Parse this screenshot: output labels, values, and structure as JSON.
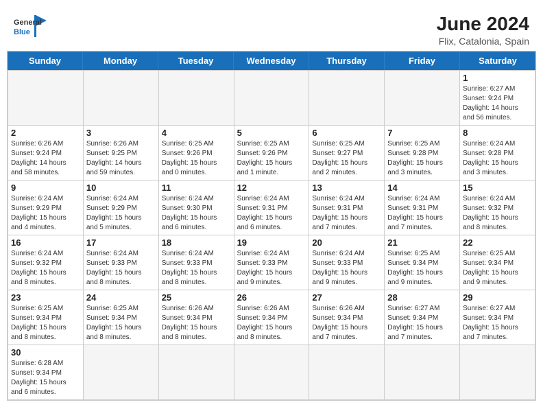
{
  "header": {
    "logo_general": "General",
    "logo_blue": "Blue",
    "title": "June 2024",
    "subtitle": "Flix, Catalonia, Spain"
  },
  "days": [
    "Sunday",
    "Monday",
    "Tuesday",
    "Wednesday",
    "Thursday",
    "Friday",
    "Saturday"
  ],
  "cells": [
    {
      "day": null,
      "empty": true
    },
    {
      "day": null,
      "empty": true
    },
    {
      "day": null,
      "empty": true
    },
    {
      "day": null,
      "empty": true
    },
    {
      "day": null,
      "empty": true
    },
    {
      "day": null,
      "empty": true
    },
    {
      "day": "1",
      "info": "Sunrise: 6:27 AM\nSunset: 9:24 PM\nDaylight: 14 hours\nand 56 minutes."
    },
    {
      "day": "2",
      "info": "Sunrise: 6:26 AM\nSunset: 9:24 PM\nDaylight: 14 hours\nand 58 minutes."
    },
    {
      "day": "3",
      "info": "Sunrise: 6:26 AM\nSunset: 9:25 PM\nDaylight: 14 hours\nand 59 minutes."
    },
    {
      "day": "4",
      "info": "Sunrise: 6:25 AM\nSunset: 9:26 PM\nDaylight: 15 hours\nand 0 minutes."
    },
    {
      "day": "5",
      "info": "Sunrise: 6:25 AM\nSunset: 9:26 PM\nDaylight: 15 hours\nand 1 minute."
    },
    {
      "day": "6",
      "info": "Sunrise: 6:25 AM\nSunset: 9:27 PM\nDaylight: 15 hours\nand 2 minutes."
    },
    {
      "day": "7",
      "info": "Sunrise: 6:25 AM\nSunset: 9:28 PM\nDaylight: 15 hours\nand 3 minutes."
    },
    {
      "day": "8",
      "info": "Sunrise: 6:24 AM\nSunset: 9:28 PM\nDaylight: 15 hours\nand 3 minutes."
    },
    {
      "day": "9",
      "info": "Sunrise: 6:24 AM\nSunset: 9:29 PM\nDaylight: 15 hours\nand 4 minutes."
    },
    {
      "day": "10",
      "info": "Sunrise: 6:24 AM\nSunset: 9:29 PM\nDaylight: 15 hours\nand 5 minutes."
    },
    {
      "day": "11",
      "info": "Sunrise: 6:24 AM\nSunset: 9:30 PM\nDaylight: 15 hours\nand 6 minutes."
    },
    {
      "day": "12",
      "info": "Sunrise: 6:24 AM\nSunset: 9:31 PM\nDaylight: 15 hours\nand 6 minutes."
    },
    {
      "day": "13",
      "info": "Sunrise: 6:24 AM\nSunset: 9:31 PM\nDaylight: 15 hours\nand 7 minutes."
    },
    {
      "day": "14",
      "info": "Sunrise: 6:24 AM\nSunset: 9:31 PM\nDaylight: 15 hours\nand 7 minutes."
    },
    {
      "day": "15",
      "info": "Sunrise: 6:24 AM\nSunset: 9:32 PM\nDaylight: 15 hours\nand 8 minutes."
    },
    {
      "day": "16",
      "info": "Sunrise: 6:24 AM\nSunset: 9:32 PM\nDaylight: 15 hours\nand 8 minutes."
    },
    {
      "day": "17",
      "info": "Sunrise: 6:24 AM\nSunset: 9:33 PM\nDaylight: 15 hours\nand 8 minutes."
    },
    {
      "day": "18",
      "info": "Sunrise: 6:24 AM\nSunset: 9:33 PM\nDaylight: 15 hours\nand 8 minutes."
    },
    {
      "day": "19",
      "info": "Sunrise: 6:24 AM\nSunset: 9:33 PM\nDaylight: 15 hours\nand 9 minutes."
    },
    {
      "day": "20",
      "info": "Sunrise: 6:24 AM\nSunset: 9:33 PM\nDaylight: 15 hours\nand 9 minutes."
    },
    {
      "day": "21",
      "info": "Sunrise: 6:25 AM\nSunset: 9:34 PM\nDaylight: 15 hours\nand 9 minutes."
    },
    {
      "day": "22",
      "info": "Sunrise: 6:25 AM\nSunset: 9:34 PM\nDaylight: 15 hours\nand 9 minutes."
    },
    {
      "day": "23",
      "info": "Sunrise: 6:25 AM\nSunset: 9:34 PM\nDaylight: 15 hours\nand 8 minutes."
    },
    {
      "day": "24",
      "info": "Sunrise: 6:25 AM\nSunset: 9:34 PM\nDaylight: 15 hours\nand 8 minutes."
    },
    {
      "day": "25",
      "info": "Sunrise: 6:26 AM\nSunset: 9:34 PM\nDaylight: 15 hours\nand 8 minutes."
    },
    {
      "day": "26",
      "info": "Sunrise: 6:26 AM\nSunset: 9:34 PM\nDaylight: 15 hours\nand 8 minutes."
    },
    {
      "day": "27",
      "info": "Sunrise: 6:26 AM\nSunset: 9:34 PM\nDaylight: 15 hours\nand 7 minutes."
    },
    {
      "day": "28",
      "info": "Sunrise: 6:27 AM\nSunset: 9:34 PM\nDaylight: 15 hours\nand 7 minutes."
    },
    {
      "day": "29",
      "info": "Sunrise: 6:27 AM\nSunset: 9:34 PM\nDaylight: 15 hours\nand 7 minutes."
    },
    {
      "day": "30",
      "info": "Sunrise: 6:28 AM\nSunset: 9:34 PM\nDaylight: 15 hours\nand 6 minutes.",
      "last_row": true
    },
    {
      "day": null,
      "empty": true,
      "last_row": true
    },
    {
      "day": null,
      "empty": true,
      "last_row": true
    },
    {
      "day": null,
      "empty": true,
      "last_row": true
    },
    {
      "day": null,
      "empty": true,
      "last_row": true
    },
    {
      "day": null,
      "empty": true,
      "last_row": true
    },
    {
      "day": null,
      "empty": true,
      "last_row": true
    }
  ]
}
